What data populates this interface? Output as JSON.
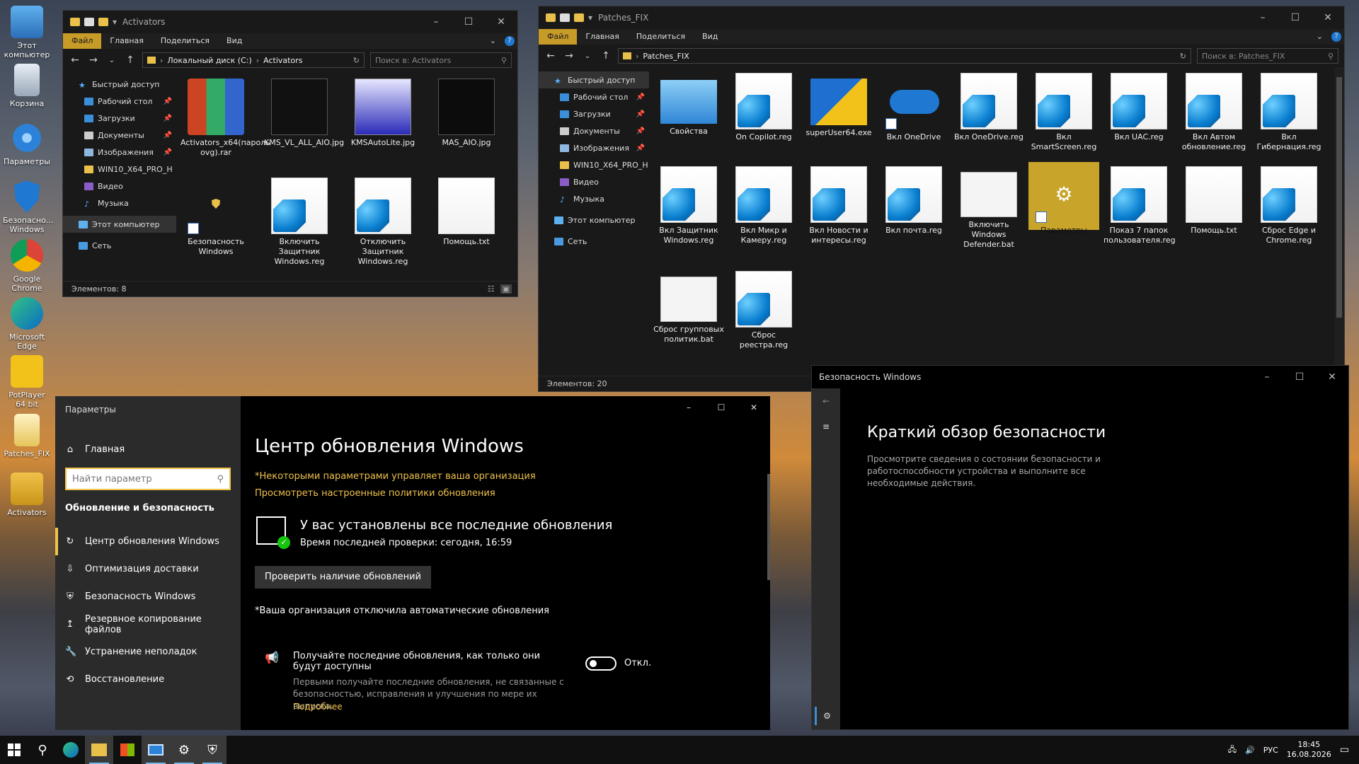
{
  "desktop": {
    "icons": [
      "Этот компьютер",
      "Корзина",
      "Параметры",
      "Безопасно... Windows",
      "Google Chrome",
      "Microsoft Edge",
      "PotPlayer 64 bit",
      "Patches_FIX",
      "Activators"
    ]
  },
  "win1": {
    "title": "Activators",
    "ribbon": [
      "Файл",
      "Главная",
      "Поделиться",
      "Вид"
    ],
    "path": [
      "Локальный диск (C:)",
      "Activators"
    ],
    "search_placeholder": "Поиск в: Activators",
    "nav": [
      "Быстрый доступ",
      "Рабочий стол",
      "Загрузки",
      "Документы",
      "Изображения",
      "WIN10_X64_PRO_H",
      "Видео",
      "Музыка",
      "Этот компьютер",
      "Сеть"
    ],
    "files": [
      "Activators_x64(пароль ovg).rar",
      "KMS_VL_ALL_AIO.jpg",
      "KMSAutoLite.jpg",
      "MAS_AIO.jpg",
      "Безопасность Windows",
      "Включить Защитник Windows.reg",
      "Отключить Защитник Windows.reg",
      "Помощь.txt"
    ],
    "status": "Элементов: 8"
  },
  "win2": {
    "title": "Patches_FIX",
    "ribbon": [
      "Файл",
      "Главная",
      "Поделиться",
      "Вид"
    ],
    "path": [
      "Patches_FIX"
    ],
    "search_placeholder": "Поиск в: Patches_FIX",
    "nav": [
      "Быстрый доступ",
      "Рабочий стол",
      "Загрузки",
      "Документы",
      "Изображения",
      "WIN10_X64_PRO_H",
      "Видео",
      "Музыка",
      "Этот компьютер",
      "Сеть"
    ],
    "files": [
      "Свойства",
      "On Copilot.reg",
      "superUser64.exe",
      "Вкл OneDrive",
      "Вкл OneDrive.reg",
      "Вкл SmartScreen.reg",
      "Вкл UAC.reg",
      "Вкл Автом обновление.reg",
      "Вкл Гибернация.reg",
      "Вкл Защитник Windows.reg",
      "Вкл Микр и Камеру.reg",
      "Вкл Новости и интересы.reg",
      "Вкл почта.reg",
      "Включить Windows Defender.bat",
      "Параметры",
      "Показ 7 папок пользователя.reg",
      "Помощь.txt",
      "Сброс Edge и Chrome.reg",
      "Сброс групповых политик.bat",
      "Сброс реестра.reg"
    ],
    "status": "Элементов: 20"
  },
  "settings": {
    "title": "Параметры",
    "home": "Главная",
    "search_placeholder": "Найти параметр",
    "section": "Обновление и безопасность",
    "nav": [
      "Центр обновления Windows",
      "Оптимизация доставки",
      "Безопасность Windows",
      "Резервное копирование файлов",
      "Устранение неполадок",
      "Восстановление"
    ],
    "heading": "Центр обновления Windows",
    "org_notice": "*Некоторыми параметрами управляет ваша организация",
    "policy_link": "Просмотреть настроенные политики обновления",
    "status_title": "У вас установлены все последние обновления",
    "status_sub": "Время последней проверки: сегодня, 16:59",
    "check_button": "Проверить наличие обновлений",
    "auto_notice": "*Ваша организация отключила автоматические обновления",
    "opt_title": "Получайте последние обновления, как только они будут доступны",
    "opt_desc": "Первыми получайте последние обновления, не связанные с безопасностью, исправления и улучшения по мере их выпуска.",
    "opt_more": "Подробнее",
    "toggle_label": "Откл."
  },
  "security": {
    "title": "Безопасность Windows",
    "heading": "Краткий обзор безопасности",
    "desc": "Просмотрите сведения о состоянии безопасности и работоспособности устройства и выполните все необходимые действия."
  },
  "taskbar": {
    "lang": "РУС",
    "time": "18:45",
    "date": "16.08.2026"
  }
}
